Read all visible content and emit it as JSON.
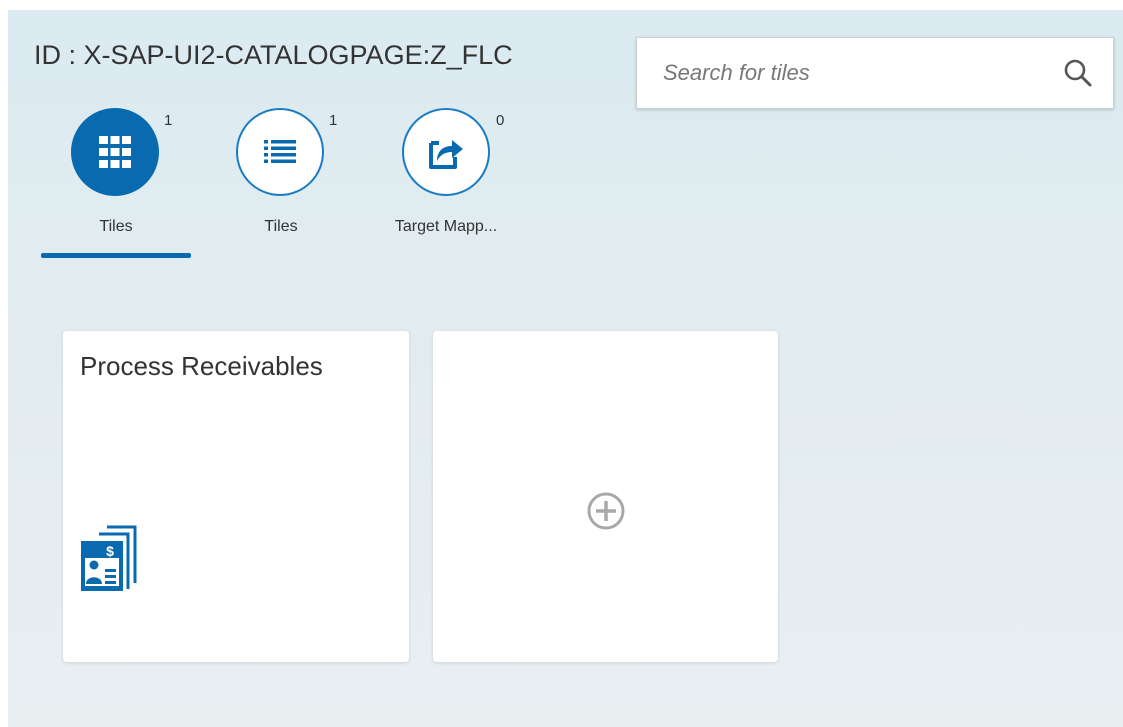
{
  "catalog": {
    "title": "ID : X-SAP-UI2-CATALOGPAGE:Z_FLC"
  },
  "search": {
    "placeholder": "Search for tiles",
    "value": "",
    "icon": "search-icon"
  },
  "tabs": [
    {
      "label": "Tiles",
      "count": "1",
      "icon": "grid-icon",
      "selected": true
    },
    {
      "label": "Tiles",
      "count": "1",
      "icon": "list-icon",
      "selected": false
    },
    {
      "label": "Target Mapp...",
      "count": "0",
      "icon": "share-icon",
      "selected": false
    }
  ],
  "tiles": [
    {
      "title": "Process Receivables",
      "icon": "receivables-icon"
    },
    {
      "title": "",
      "icon": "add-icon"
    }
  ],
  "colors": {
    "accent": "#0a6aaf",
    "text": "#333333",
    "background": "#dbebf1"
  }
}
